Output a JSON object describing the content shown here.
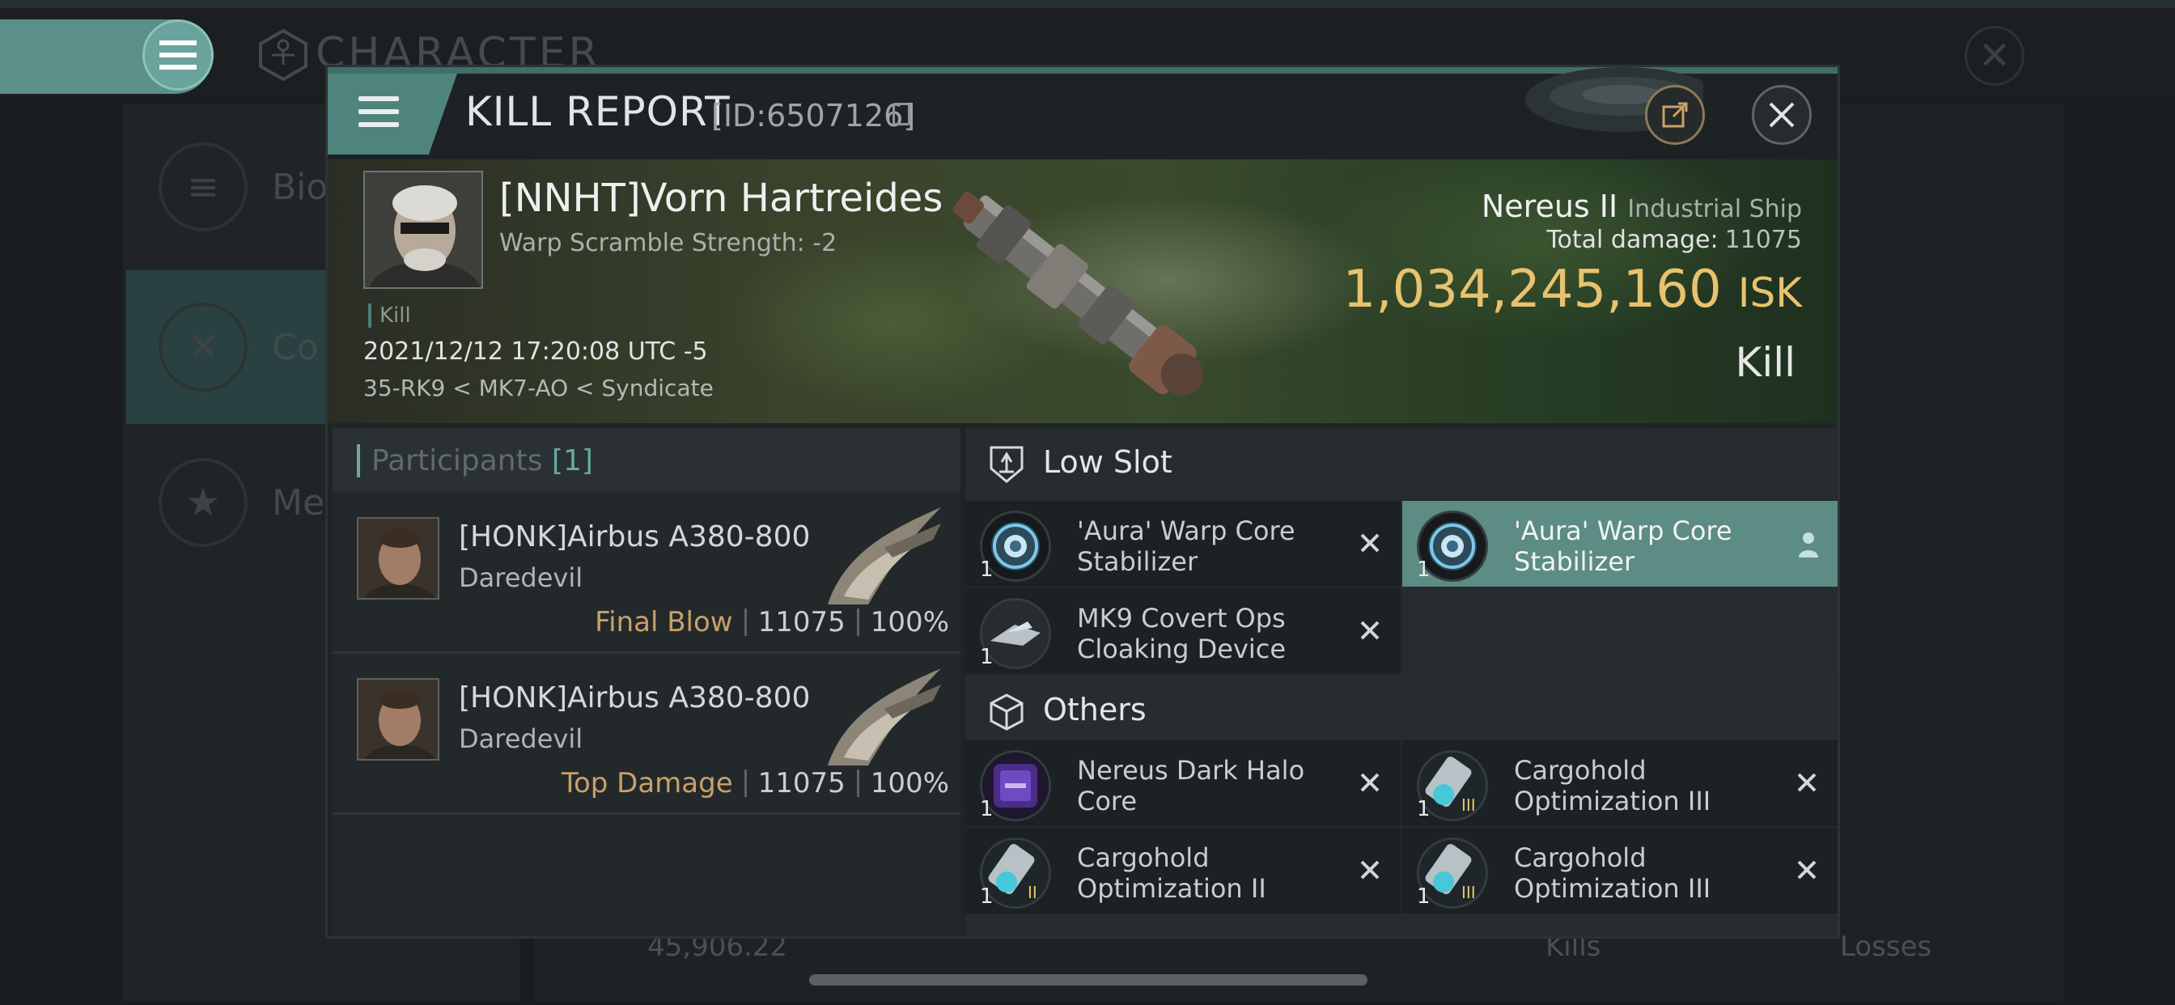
{
  "background": {
    "screen_title": "CHARACTER",
    "side_items": [
      {
        "label": "Bio"
      },
      {
        "label": "Co"
      },
      {
        "label": "Me"
      }
    ],
    "bottom_value": "45,906.22",
    "bottom_kills": "Kills",
    "bottom_losses": "Losses"
  },
  "modal": {
    "title": "KILL REPORT",
    "id": "[ID:6507126]",
    "victim": {
      "name": "[NNHT]Vorn Hartreides",
      "warp_scramble": "Warp Scramble Strength: -2",
      "kill_tag": "Kill",
      "datetime": "2021/12/12 17:20:08 UTC -5",
      "location": "35-RK9 < MK7-AO < Syndicate",
      "ship_name": "Nereus II",
      "ship_class": "Industrial Ship",
      "total_damage_label": "Total damage:",
      "total_damage": "11075",
      "isk_value": "1,034,245,160",
      "isk_unit": "ISK",
      "outcome": "Kill"
    },
    "participants": {
      "title": "Participants",
      "count": "[1]",
      "rows": [
        {
          "name": "[HONK]Airbus A380-800",
          "ship": "Daredevil",
          "tag": "Final Blow",
          "damage": "11075",
          "percent": "100%"
        },
        {
          "name": "[HONK]Airbus A380-800",
          "ship": "Daredevil",
          "tag": "Top Damage",
          "damage": "11075",
          "percent": "100%"
        }
      ]
    },
    "sections": {
      "low_slot": "Low Slot",
      "others": "Others"
    },
    "items": [
      {
        "name": "'Aura' Warp Core Stabilizer",
        "qty": "1",
        "status": "destroyed"
      },
      {
        "name": "'Aura' Warp Core Stabilizer",
        "qty": "1",
        "status": "dropped"
      },
      {
        "name": "MK9 Covert Ops Cloaking Device",
        "qty": "1",
        "status": "destroyed"
      },
      {
        "name": "Nereus Dark Halo Core",
        "qty": "1",
        "status": "destroyed"
      },
      {
        "name": "Cargohold Optimization III",
        "qty": "1",
        "status": "destroyed"
      },
      {
        "name": "Cargohold Optimization II",
        "qty": "1",
        "status": "destroyed"
      },
      {
        "name": "Cargohold Optimization III",
        "qty": "1",
        "status": "destroyed"
      }
    ]
  },
  "colors": {
    "accent_teal": "#5c8c84",
    "isk_gold": "#e8c26e",
    "tag_gold": "#c8a168"
  }
}
